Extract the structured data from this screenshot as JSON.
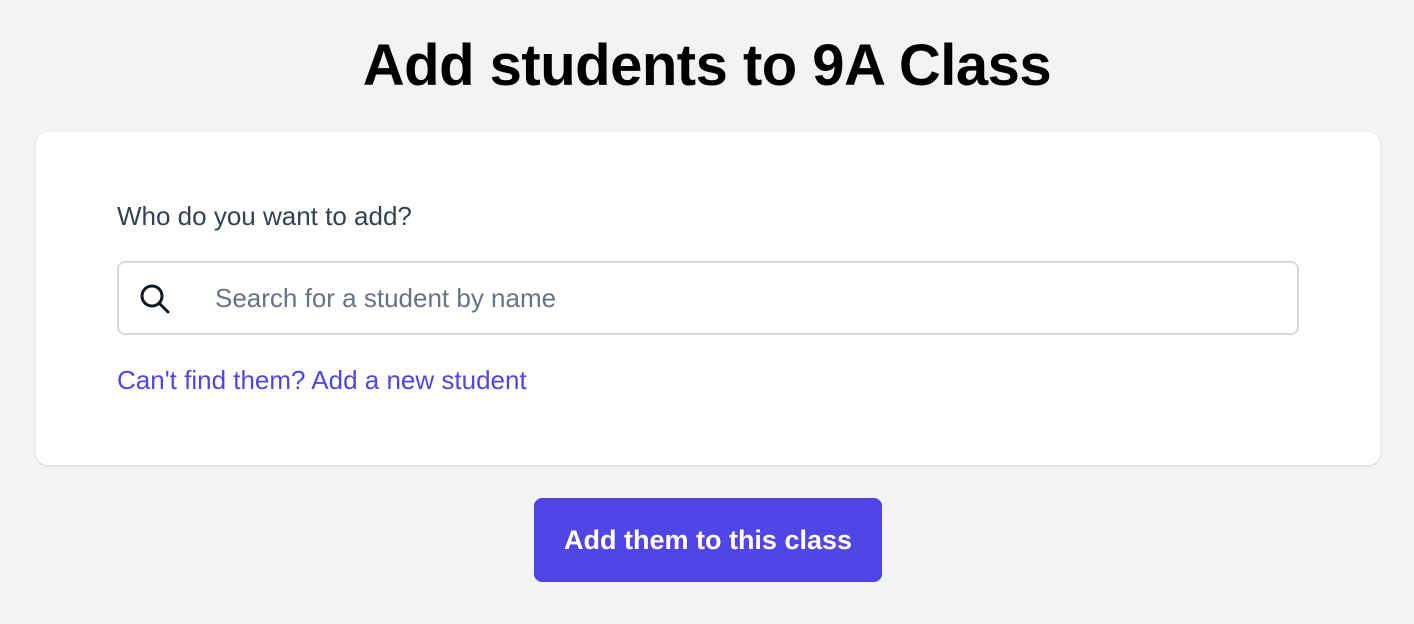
{
  "page": {
    "title": "Add students to 9A Class"
  },
  "form": {
    "label": "Who do you want to add?",
    "search": {
      "placeholder": "Search for a student by name",
      "value": "",
      "icon": "search-icon"
    },
    "add_new_link": "Can't find them? Add a new student"
  },
  "actions": {
    "submit_label": "Add them to this class"
  },
  "colors": {
    "accent": "#4f46e5",
    "background": "#f2f3f5",
    "card": "#ffffff"
  }
}
